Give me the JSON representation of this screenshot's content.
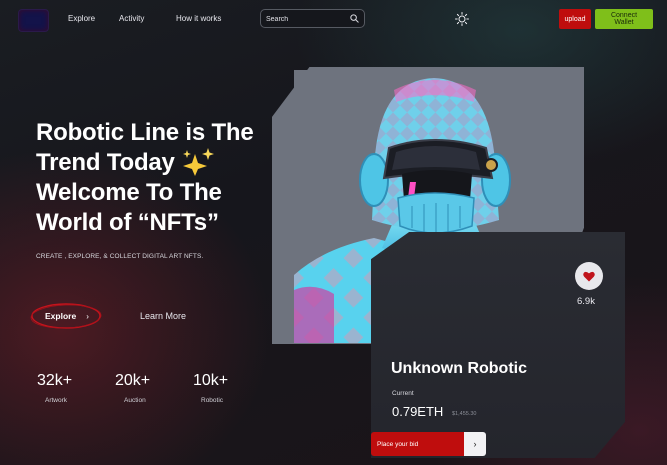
{
  "nav": {
    "links": [
      "Explore",
      "Activity",
      "How it works"
    ],
    "search_placeholder": "Search",
    "upload_label": "upload",
    "connect_label": "Connect Wallet"
  },
  "hero": {
    "title_lines": [
      "Robotic Line is The",
      "Trend Today",
      "Welcome To The",
      "World of “NFTs”"
    ],
    "subtitle": "CREATE , EXPLORE, & COLLECT DIGITAL ART NFTS.",
    "explore_label": "Explore",
    "learn_more_label": "Learn More"
  },
  "stats": [
    {
      "value": "32k+",
      "label": "Artwork"
    },
    {
      "value": "20k+",
      "label": "Auction"
    },
    {
      "value": "10k+",
      "label": "Robotic"
    }
  ],
  "nft": {
    "name": "Unknown Robotic",
    "current_label": "Current",
    "price": "0.79ETH",
    "usd": "$1,455.30",
    "likes": "6.9k",
    "bid_label": "Place your bid"
  },
  "icons": {
    "search": "search-icon",
    "theme": "sun-icon",
    "like": "heart-icon",
    "sparkle": "sparkles-icon",
    "arrow": "chevron-right-icon"
  },
  "colors": {
    "upload": "#bf0d0d",
    "connect": "#7fbf1a",
    "bid": "#bf0d0d",
    "heart": "#c0141c"
  }
}
